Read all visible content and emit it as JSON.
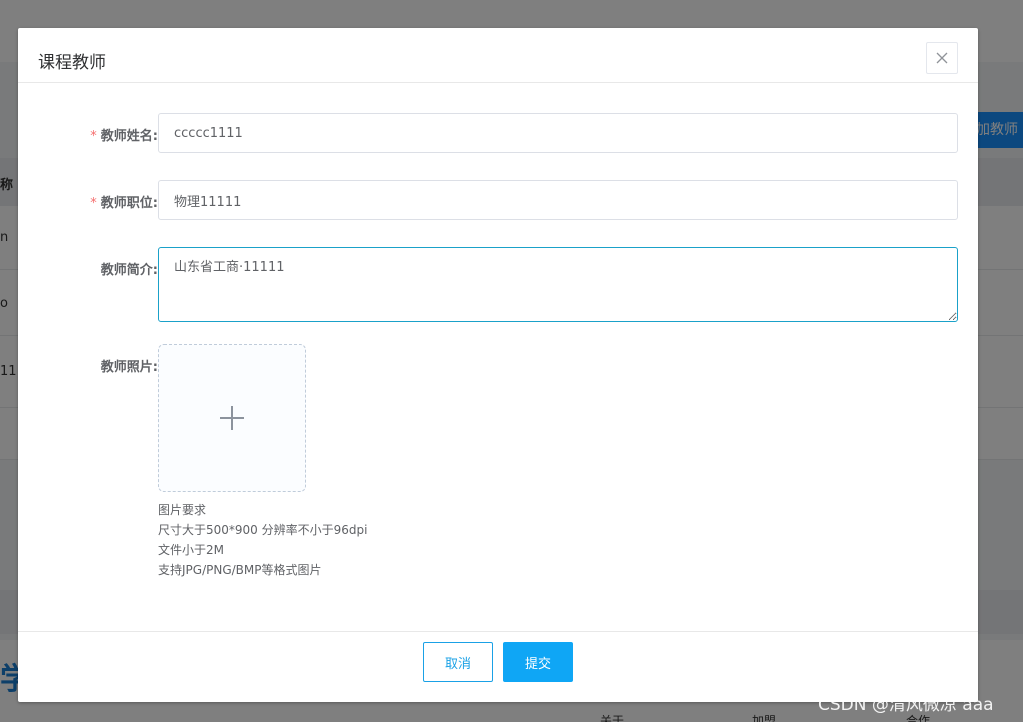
{
  "background": {
    "add_button_label": "加教师",
    "table_header_cell": "称",
    "rows": [
      {
        "text": "n"
      },
      {
        "text": "o"
      },
      {
        "text": "11"
      }
    ],
    "bottom_logo": "学",
    "bottom_links": [
      "关于",
      "加盟",
      "合作"
    ]
  },
  "dialog": {
    "title": "课程教师",
    "close_icon": "close-icon",
    "fields": {
      "name": {
        "label": "教师姓名:",
        "required": true,
        "value": "ccccc1111"
      },
      "position": {
        "label": "教师职位:",
        "required": true,
        "value": "物理11111"
      },
      "intro": {
        "label": "教师简介:",
        "required": false,
        "value": "山东省工商·11111"
      },
      "photo": {
        "label": "教师照片:",
        "required": false
      }
    },
    "upload_tips": [
      "图片要求",
      "尺寸大于500*900 分辨率不小于96dpi",
      "文件小于2M",
      "支持JPG/PNG/BMP等格式图片"
    ],
    "required_mark": "*",
    "cancel_label": "取消",
    "submit_label": "提交"
  },
  "watermark": "CSDN @清风微凉 aaa",
  "colors": {
    "primary": "#0fa6f5",
    "required": "#f56c6c",
    "focus_border": "#1aa1c9"
  }
}
